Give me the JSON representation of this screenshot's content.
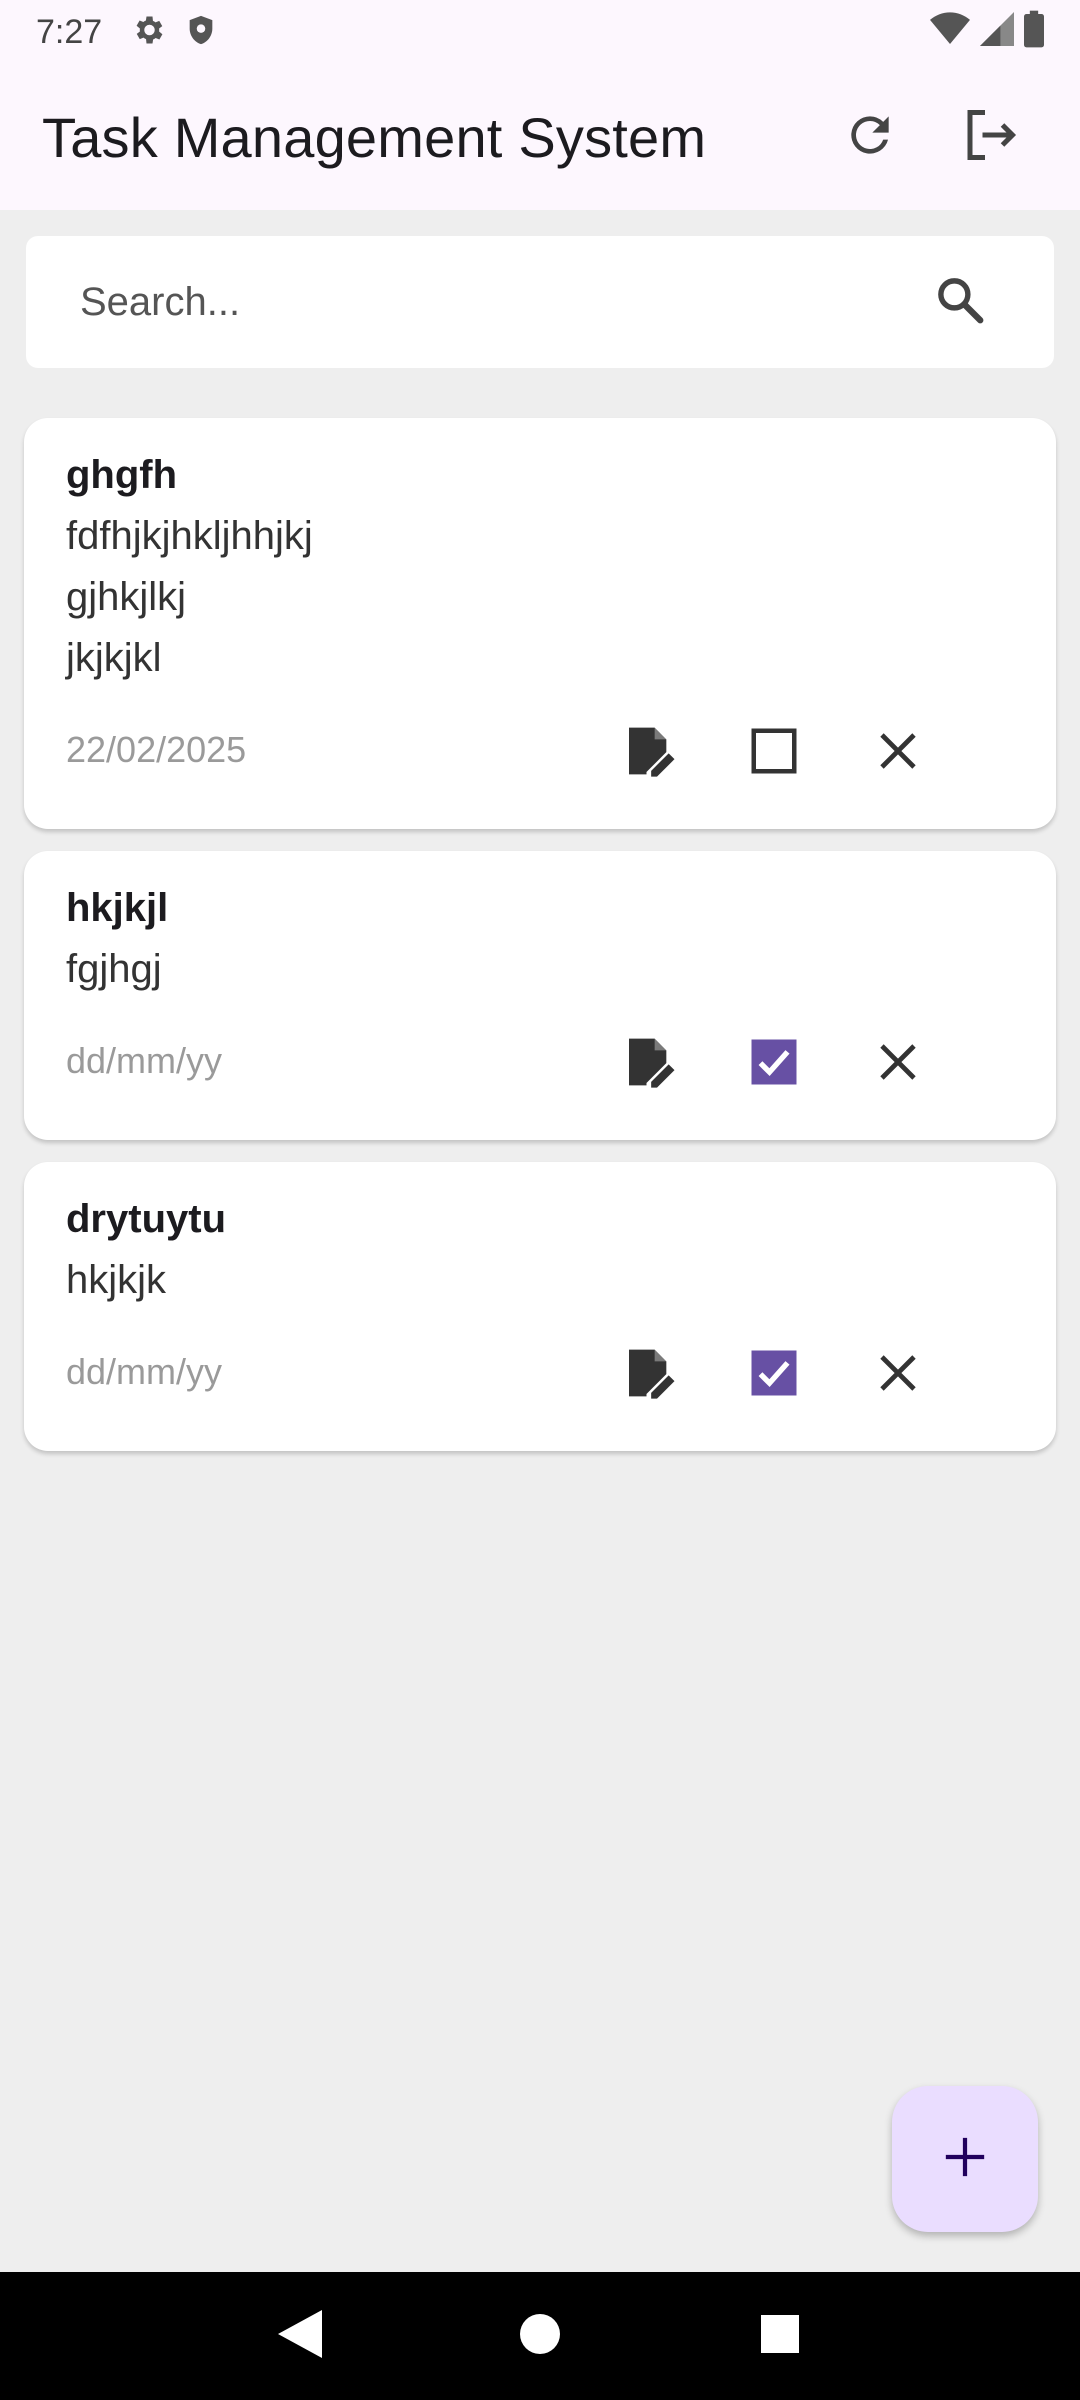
{
  "status_bar": {
    "time": "7:27",
    "left_icons": [
      "gear-icon",
      "shield-icon"
    ],
    "right_icons": [
      "wifi-icon",
      "signal-icon",
      "battery-icon"
    ]
  },
  "app_bar": {
    "title": "Task Management System",
    "actions": [
      "refresh-icon",
      "logout-icon"
    ]
  },
  "search": {
    "placeholder": "Search...",
    "value": "",
    "icon": "search-icon"
  },
  "tasks": [
    {
      "title": "ghgfh",
      "description": "fdfhjkjhkljhhjkj\ngjhkjlkj\njkjkjkl",
      "date": "22/02/2025",
      "completed": false
    },
    {
      "title": "hkjkjl",
      "description": "fgjhgj",
      "date": "dd/mm/yy",
      "completed": true
    },
    {
      "title": "drytuytu",
      "description": "hkjkjk",
      "date": "dd/mm/yy",
      "completed": true
    }
  ],
  "task_action_icons": [
    "edit-note-icon",
    "checkbox-icon",
    "close-icon"
  ],
  "fab": {
    "icon": "plus-icon"
  },
  "nav_bar": {
    "buttons": [
      "back-icon",
      "home-icon",
      "recents-icon"
    ]
  },
  "colors": {
    "app_bar_bg": "#fdf7fe",
    "page_bg": "#eeeeee",
    "checkbox_checked": "#6750a4",
    "fab_bg": "#eaddff",
    "fab_icon": "#21005d",
    "date_text": "#9a9a9a"
  }
}
